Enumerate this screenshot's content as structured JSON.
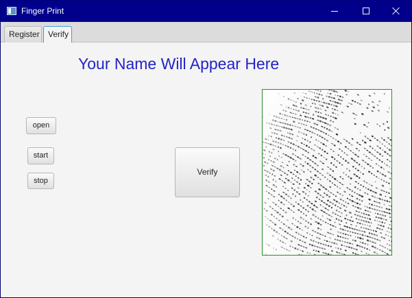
{
  "window": {
    "title": "Finger Print",
    "title_bar_color": "#00008b"
  },
  "tabs": [
    {
      "label": "Register",
      "selected": false
    },
    {
      "label": "Verify",
      "selected": true
    }
  ],
  "main": {
    "heading": "Your Name Will Appear Here",
    "heading_color": "#2323c8",
    "buttons": {
      "open": "open",
      "start": "start",
      "stop": "stop",
      "verify": "Verify"
    },
    "fingerprint_image": {
      "icon": "fingerprint-image",
      "border_color": "#2a8a2a"
    }
  },
  "icons": {
    "app": "app-icon",
    "minimize": "minimize-icon",
    "maximize": "maximize-icon",
    "close": "close-icon"
  }
}
